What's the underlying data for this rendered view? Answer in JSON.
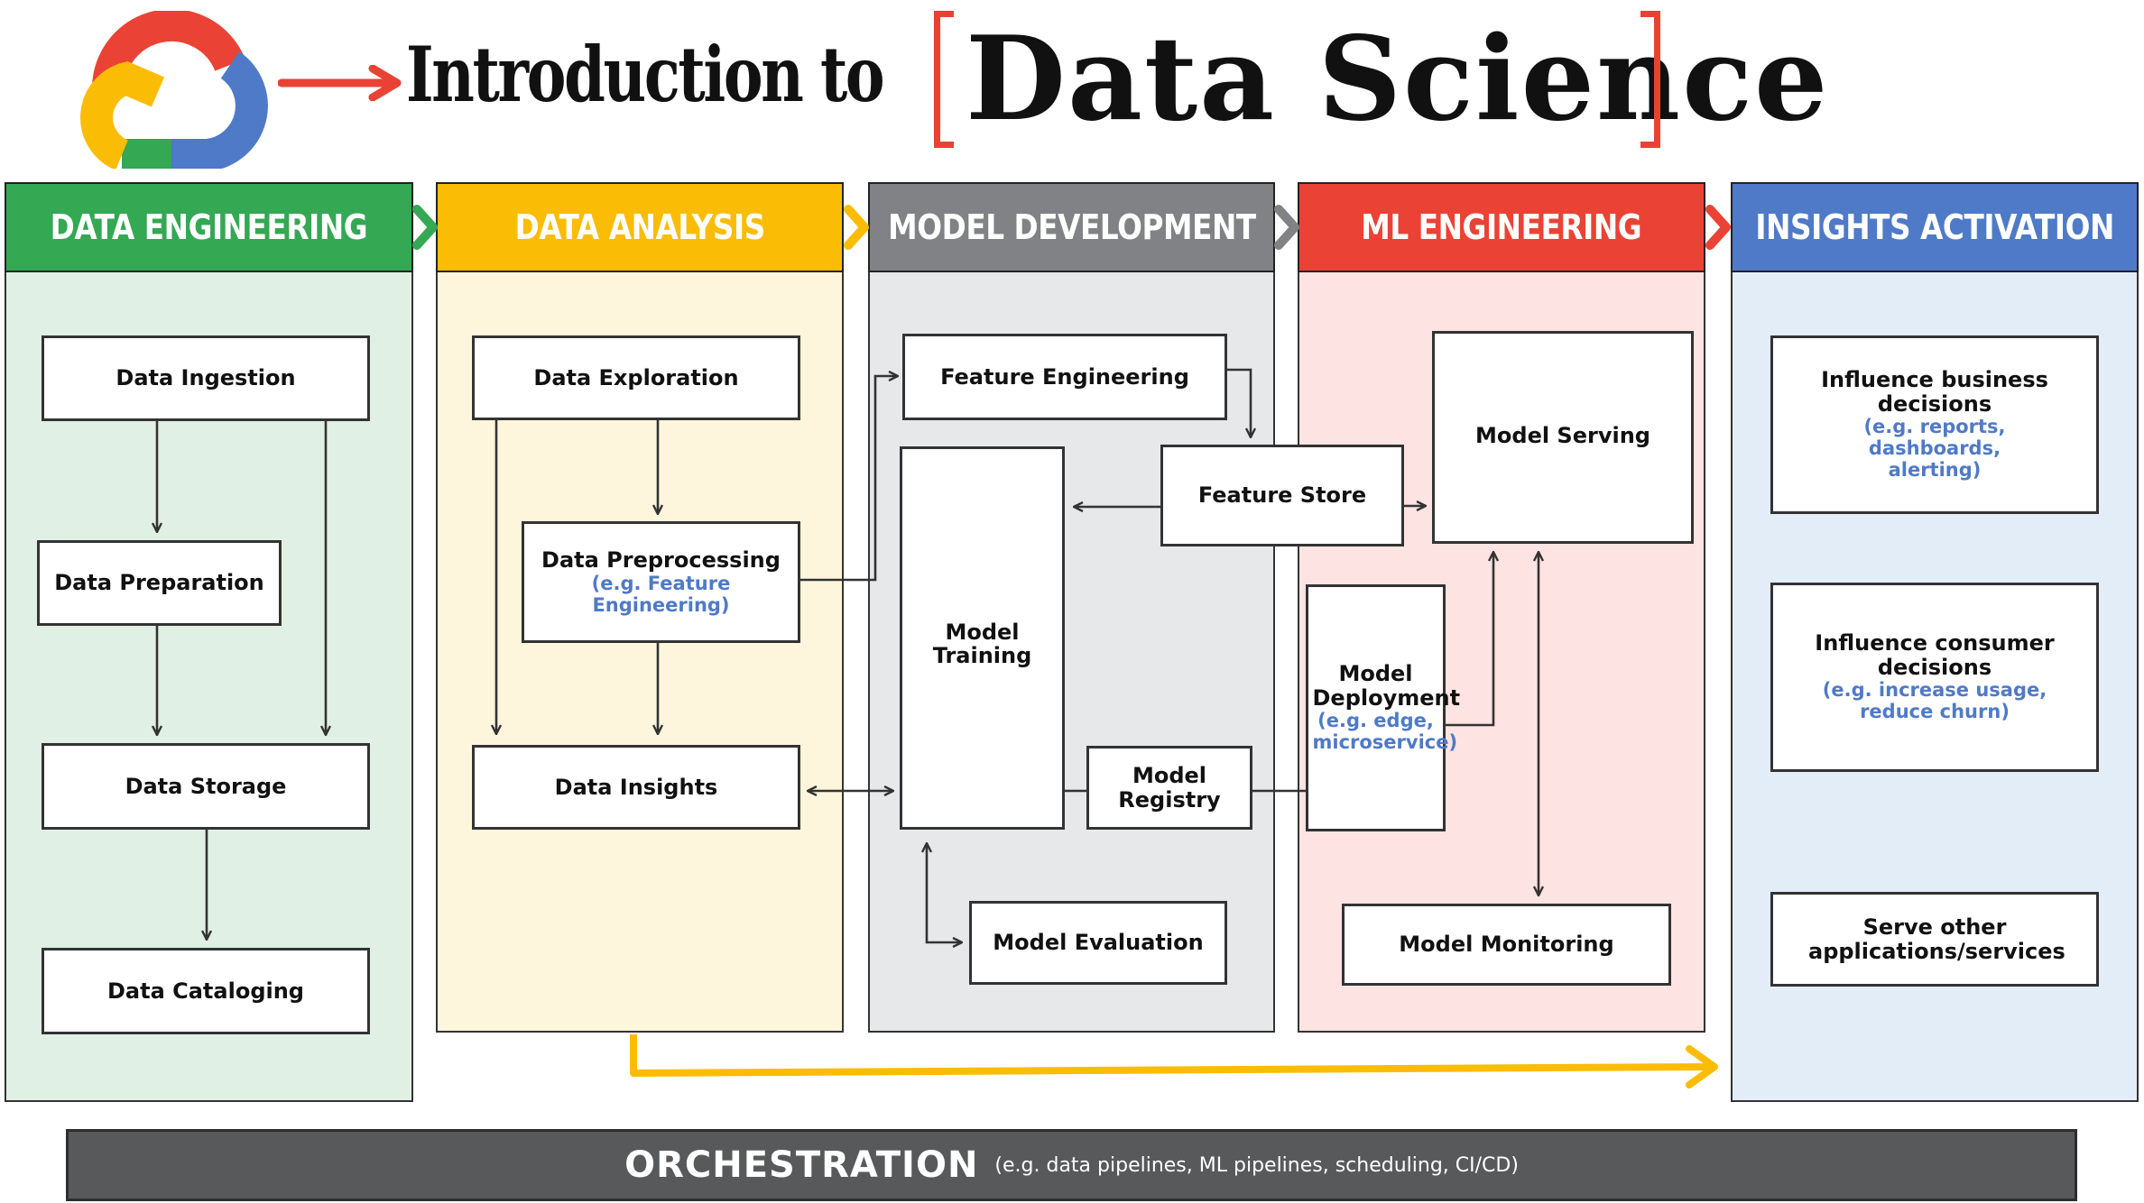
{
  "header": {
    "logo_icon": "google-cloud-logo-icon",
    "title_prefix": "Introduction to",
    "title_main": "Data Science"
  },
  "colors": {
    "green": "#34a853",
    "yellow": "#fbbc05",
    "gray": "#808285",
    "red": "#ea4335",
    "blue": "#4f7ac7",
    "green_bg": "#e1f0e4",
    "yellow_bg": "#fdf6dc",
    "gray_bg": "#e7e8ea",
    "red_bg": "#fde3e1",
    "blue_bg": "#e3edf8",
    "orchestration_bg": "#58595b"
  },
  "columns": [
    {
      "id": "data-engineering",
      "title": "DATA ENGINEERING",
      "boxes": [
        {
          "label": "Data Ingestion"
        },
        {
          "label": "Data Preparation"
        },
        {
          "label": "Data Storage"
        },
        {
          "label": "Data Cataloging"
        }
      ]
    },
    {
      "id": "data-analysis",
      "title": "DATA ANALYSIS",
      "boxes": [
        {
          "label": "Data Exploration"
        },
        {
          "label": "Data Preprocessing",
          "sub": "(e.g. Feature Engineering)"
        },
        {
          "label": "Data Insights"
        }
      ]
    },
    {
      "id": "model-development",
      "title": "MODEL DEVELOPMENT",
      "boxes": [
        {
          "label": "Feature Engineering"
        },
        {
          "label": "Model Training"
        },
        {
          "label": "Model Registry"
        },
        {
          "label": "Model Evaluation"
        },
        {
          "label": "Feature Store"
        }
      ]
    },
    {
      "id": "ml-engineering",
      "title": "ML ENGINEERING",
      "boxes": [
        {
          "label": "Model Serving"
        },
        {
          "label": "Model Deployment",
          "sub": "(e.g. edge, microservice)"
        },
        {
          "label": "Model Monitoring"
        }
      ]
    },
    {
      "id": "insights-activation",
      "title": "INSIGHTS ACTIVATION",
      "boxes": [
        {
          "label": "Influence business decisions",
          "sub": "(e.g. reports, dashboards, alerting)"
        },
        {
          "label": "Influence consumer decisions",
          "sub": "(e.g. increase usage, reduce churn)"
        },
        {
          "label": "Serve other applications/services"
        }
      ]
    }
  ],
  "orchestration": {
    "title": "ORCHESTRATION",
    "sub": "(e.g. data pipelines, ML pipelines, scheduling, CI/CD)"
  },
  "connections": [
    {
      "from": "Data Ingestion",
      "to": "Data Preparation"
    },
    {
      "from": "Data Ingestion",
      "to": "Data Storage"
    },
    {
      "from": "Data Preparation",
      "to": "Data Storage"
    },
    {
      "from": "Data Storage",
      "to": "Data Cataloging"
    },
    {
      "from": "Data Exploration",
      "to": "Data Preprocessing"
    },
    {
      "from": "Data Exploration",
      "to": "Data Insights"
    },
    {
      "from": "Data Preprocessing",
      "to": "Data Insights"
    },
    {
      "from": "Data Preprocessing",
      "to": "Feature Engineering"
    },
    {
      "from": "Data Insights",
      "to": "Model Training",
      "bidirectional": true
    },
    {
      "from": "Feature Engineering",
      "to": "Feature Store"
    },
    {
      "from": "Feature Store",
      "to": "Model Training"
    },
    {
      "from": "Feature Store",
      "to": "Model Serving"
    },
    {
      "from": "Model Training",
      "to": "Model Registry"
    },
    {
      "from": "Model Training",
      "to": "Model Evaluation",
      "bidirectional": true
    },
    {
      "from": "Model Registry",
      "to": "Model Deployment"
    },
    {
      "from": "Model Deployment",
      "to": "Model Serving"
    },
    {
      "from": "Model Serving",
      "to": "Model Monitoring",
      "bidirectional": true
    },
    {
      "from": "Data Analysis",
      "to": "Insights Activation"
    }
  ]
}
